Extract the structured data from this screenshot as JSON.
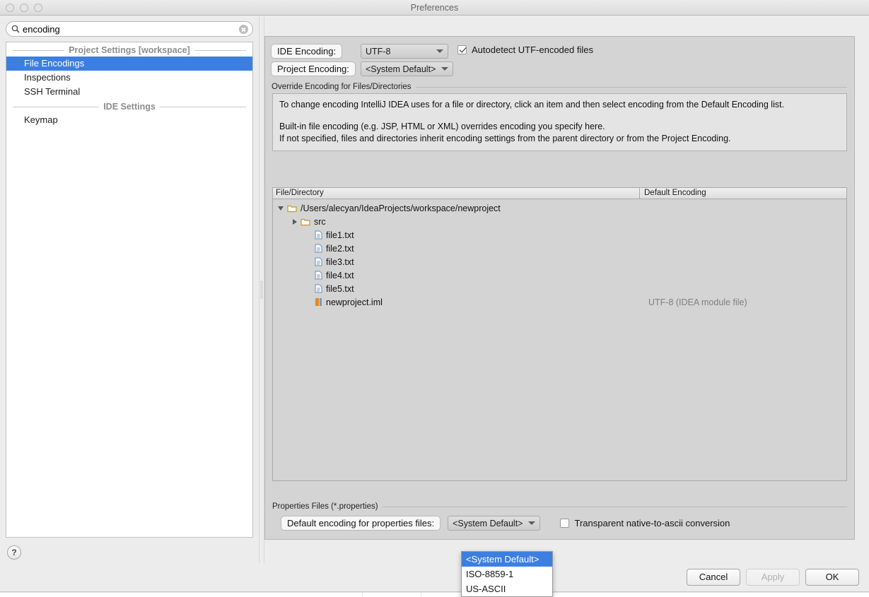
{
  "window": {
    "title": "Preferences",
    "traffic_lights": [
      "close-button",
      "minimize-button",
      "zoom-button"
    ]
  },
  "search": {
    "value": "encoding",
    "placeholder": "",
    "icon": "search-icon",
    "clear_icon": "clear-icon"
  },
  "sidebar": {
    "sections": [
      {
        "label": "Project Settings [workspace]",
        "items": [
          {
            "label": "File Encodings",
            "selected": true
          },
          {
            "label": "Inspections",
            "selected": false
          },
          {
            "label": "SSH Terminal",
            "selected": false
          }
        ]
      },
      {
        "label": "IDE Settings",
        "items": [
          {
            "label": "Keymap",
            "selected": false
          }
        ]
      }
    ],
    "help_label": "?"
  },
  "panel": {
    "title": "File Encodings",
    "ide_encoding_label": "IDE Encoding:",
    "ide_encoding_value": "UTF-8",
    "project_encoding_label": "Project Encoding:",
    "project_encoding_value": "<System Default>",
    "autodetect_label": "Autodetect UTF-encoded files",
    "autodetect_checked": true
  },
  "override_group": {
    "title": "Override Encoding for Files/Directories",
    "paragraph1": "To change encoding IntelliJ IDEA uses for a file or directory, click an item and then select encoding from the Default Encoding list.",
    "paragraph2": "Built-in file encoding (e.g. JSP, HTML or XML) overrides encoding you specify here.",
    "paragraph3": "If not specified, files and directories inherit encoding settings from the parent directory or from the Project Encoding."
  },
  "table": {
    "columns": [
      "File/Directory",
      "Default Encoding"
    ],
    "rows": [
      {
        "name": "/Users/alecyan/IdeaProjects/workspace/newproject",
        "encoding": "",
        "indent": 0,
        "twisty": "expanded",
        "icon": "folder-icon"
      },
      {
        "name": "src",
        "encoding": "",
        "indent": 1,
        "twisty": "collapsed",
        "icon": "folder-icon"
      },
      {
        "name": "file1.txt",
        "encoding": "",
        "indent": 2,
        "twisty": "none",
        "icon": "text-file-icon"
      },
      {
        "name": "file2.txt",
        "encoding": "",
        "indent": 2,
        "twisty": "none",
        "icon": "text-file-icon"
      },
      {
        "name": "file3.txt",
        "encoding": "",
        "indent": 2,
        "twisty": "none",
        "icon": "text-file-icon"
      },
      {
        "name": "file4.txt",
        "encoding": "",
        "indent": 2,
        "twisty": "none",
        "icon": "text-file-icon"
      },
      {
        "name": "file5.txt",
        "encoding": "",
        "indent": 2,
        "twisty": "none",
        "icon": "text-file-icon"
      },
      {
        "name": "newproject.iml",
        "encoding": "UTF-8 (IDEA module file)",
        "indent": 2,
        "twisty": "none",
        "icon": "iml-file-icon"
      }
    ]
  },
  "properties_group": {
    "title": "Properties Files (*.properties)",
    "default_encoding_label": "Default encoding for properties files:",
    "default_encoding_value": "<System Default>",
    "transparent_label": "Transparent native-to-ascii conversion",
    "transparent_checked": false
  },
  "dropdown_popup": {
    "open": true,
    "options": [
      {
        "label": "<System Default>",
        "selected": true
      },
      {
        "label": "ISO-8859-1",
        "selected": false
      },
      {
        "label": "US-ASCII",
        "selected": false
      }
    ]
  },
  "footer": {
    "cancel": "Cancel",
    "apply": "Apply",
    "apply_disabled": true,
    "ok": "OK"
  },
  "colors": {
    "selection": "#3d7fe0",
    "panel_header": "#a8c3e8",
    "window_bg": "#ececec",
    "folder_icon": "#c8a24a",
    "file_icon": "#7ba0c4"
  }
}
